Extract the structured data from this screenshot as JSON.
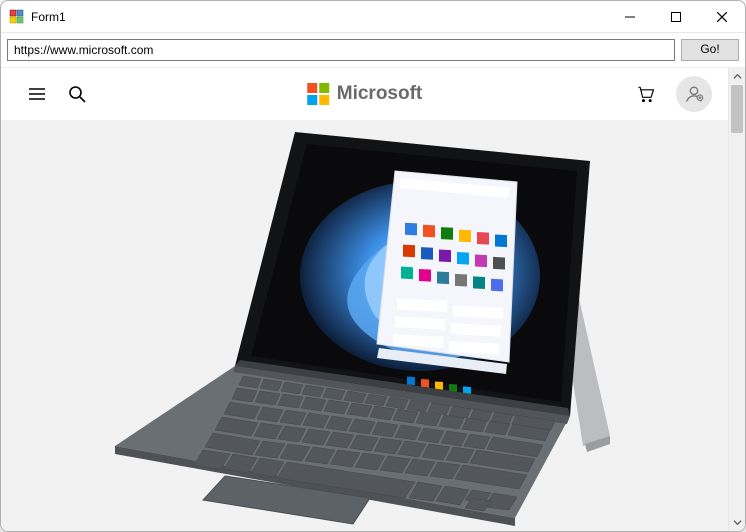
{
  "window": {
    "title": "Form1"
  },
  "urlbar": {
    "value": "https://www.microsoft.com",
    "go_label": "Go!"
  },
  "ms_header": {
    "brand": "Microsoft",
    "logo_colors": {
      "tl": "#f25022",
      "tr": "#7fba00",
      "bl": "#00a4ef",
      "br": "#ffb900"
    }
  },
  "hero": {
    "product": "Surface laptop with detachable keyboard showing Windows 11 Start menu"
  }
}
